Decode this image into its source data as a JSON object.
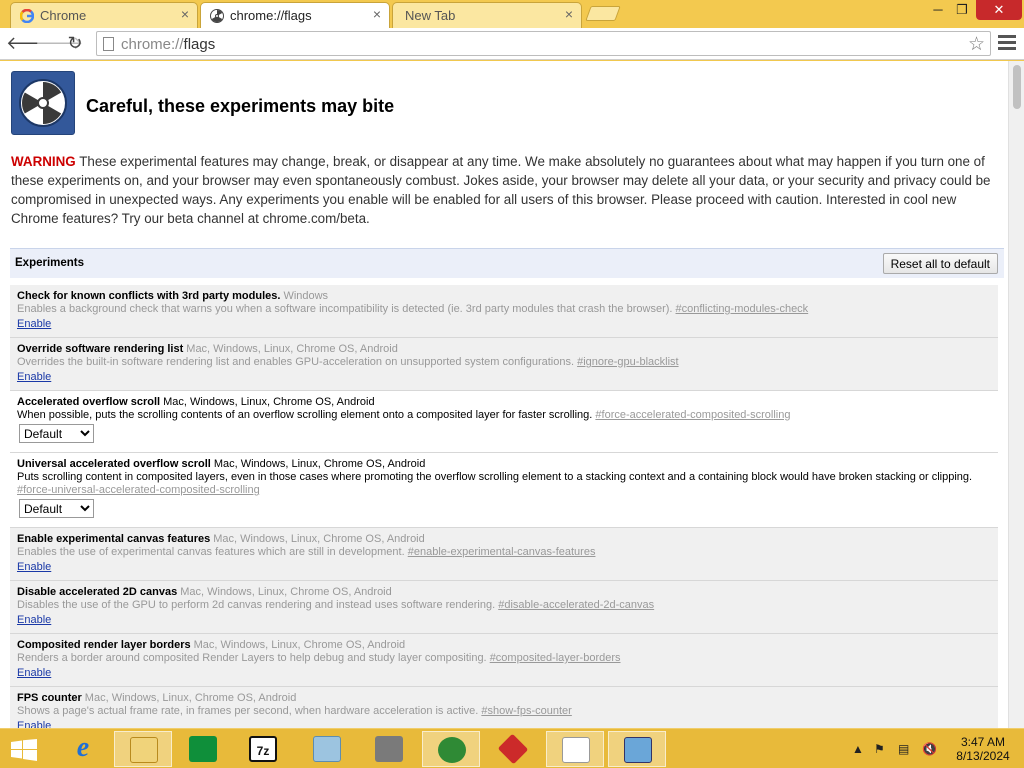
{
  "browser": {
    "tabs": [
      {
        "label": "Chrome",
        "icon": "google-icon",
        "active": false
      },
      {
        "label": "chrome://flags",
        "icon": "radiation-icon",
        "active": true
      },
      {
        "label": "New Tab",
        "icon": "",
        "active": false
      }
    ],
    "url_scheme": "chrome://",
    "url_path": "flags"
  },
  "page": {
    "title": "Careful, these experiments may bite",
    "warning_label": "WARNING",
    "warning_text": " These experimental features may change, break, or disappear at any time. We make absolutely no guarantees about what may happen if you turn one of these experiments on, and your browser may even spontaneously combust. Jokes aside, your browser may delete all your data, or your security and privacy could be compromised in unexpected ways. Any experiments you enable will be enabled for all users of this browser. Please proceed with caution. Interested in cool new Chrome features? Try our beta channel at chrome.com/beta.",
    "experiments_label": "Experiments",
    "reset_label": "Reset all to default"
  },
  "experiments": [
    {
      "name": "Check for known conflicts with 3rd party modules.",
      "platforms": "Windows",
      "description": "Enables a background check that warns you when a software incompatibility is detected (ie. 3rd party modules that crash the browser).",
      "hash": "#conflicting-modules-check",
      "control": "Enable"
    },
    {
      "name": "Override software rendering list",
      "platforms": "Mac, Windows, Linux, Chrome OS, Android",
      "description": "Overrides the built-in software rendering list and enables GPU-acceleration on unsupported system configurations.",
      "hash": "#ignore-gpu-blacklist",
      "control": "Enable"
    },
    {
      "name": "Accelerated overflow scroll",
      "platforms": "Mac, Windows, Linux, Chrome OS, Android",
      "description": "When possible, puts the scrolling contents of an overflow scrolling element onto a composited layer for faster scrolling.",
      "hash": "#force-accelerated-composited-scrolling",
      "control": "Default"
    },
    {
      "name": "Universal accelerated overflow scroll",
      "platforms": "Mac, Windows, Linux, Chrome OS, Android",
      "description": "Puts scrolling content in composited layers, even in those cases where promoting the overflow scrolling element to a stacking context and a containing block would have broken stacking or clipping.",
      "hash": "#force-universal-accelerated-composited-scrolling",
      "control": "Default"
    },
    {
      "name": "Enable experimental canvas features",
      "platforms": "Mac, Windows, Linux, Chrome OS, Android",
      "description": "Enables the use of experimental canvas features which are still in development.",
      "hash": "#enable-experimental-canvas-features",
      "control": "Enable"
    },
    {
      "name": "Disable accelerated 2D canvas",
      "platforms": "Mac, Windows, Linux, Chrome OS, Android",
      "description": "Disables the use of the GPU to perform 2d canvas rendering and instead uses software rendering.",
      "hash": "#disable-accelerated-2d-canvas",
      "control": "Enable"
    },
    {
      "name": "Composited render layer borders",
      "platforms": "Mac, Windows, Linux, Chrome OS, Android",
      "description": "Renders a border around composited Render Layers to help debug and study layer compositing.",
      "hash": "#composited-layer-borders",
      "control": "Enable"
    },
    {
      "name": "FPS counter",
      "platforms": "Mac, Windows, Linux, Chrome OS, Android",
      "description": "Shows a page's actual frame rate, in frames per second, when hardware acceleration is active.",
      "hash": "#show-fps-counter",
      "control": "Enable"
    }
  ],
  "taskbar": {
    "apps": [
      {
        "name": "start-button-icon"
      },
      {
        "name": "internet-explorer-icon"
      },
      {
        "name": "file-explorer-icon"
      },
      {
        "name": "windows-store-icon"
      },
      {
        "name": "7zip-icon",
        "label": "7z"
      },
      {
        "name": "notepad-icon"
      },
      {
        "name": "archive-tool-icon"
      },
      {
        "name": "download-manager-icon"
      },
      {
        "name": "pdf-app-icon"
      },
      {
        "name": "document-icon"
      },
      {
        "name": "control-panel-icon"
      }
    ],
    "time": "3:47 AM",
    "date": "8/13/2024"
  },
  "colors": {
    "taskbar": "#e8ba3a",
    "titlebar": "#f3c94f",
    "warning": "#cc0000",
    "link": "#1a39a7"
  }
}
